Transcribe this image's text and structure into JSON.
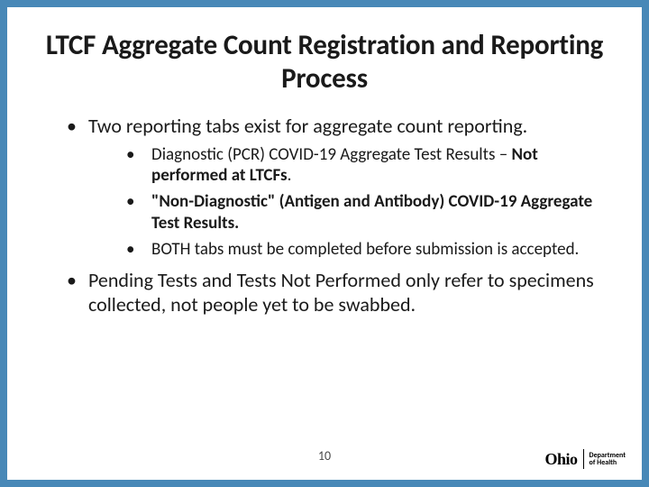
{
  "title": "LTCF Aggregate Count Registration and Reporting Process",
  "bullets": {
    "b0": "Two reporting tabs exist for aggregate count reporting.",
    "b0_sub": {
      "s0a": "Diagnostic (PCR) COVID-19 Aggregate Test Results",
      "s0b": " – ",
      "s0c": "Not performed at LTCFs",
      "s0d": ".",
      "s1a": "\"Non-Diagnostic\" (Antigen and Antibody) COVID-19 Aggregate Test Results.",
      "s2": "BOTH tabs must be completed before submission is accepted."
    },
    "b1": "Pending Tests and Tests Not Performed only refer to specimens collected, not people yet to be swabbed."
  },
  "page_number": "10",
  "logo": {
    "state": "Ohio",
    "line1": "Department",
    "line2": "of Health"
  }
}
